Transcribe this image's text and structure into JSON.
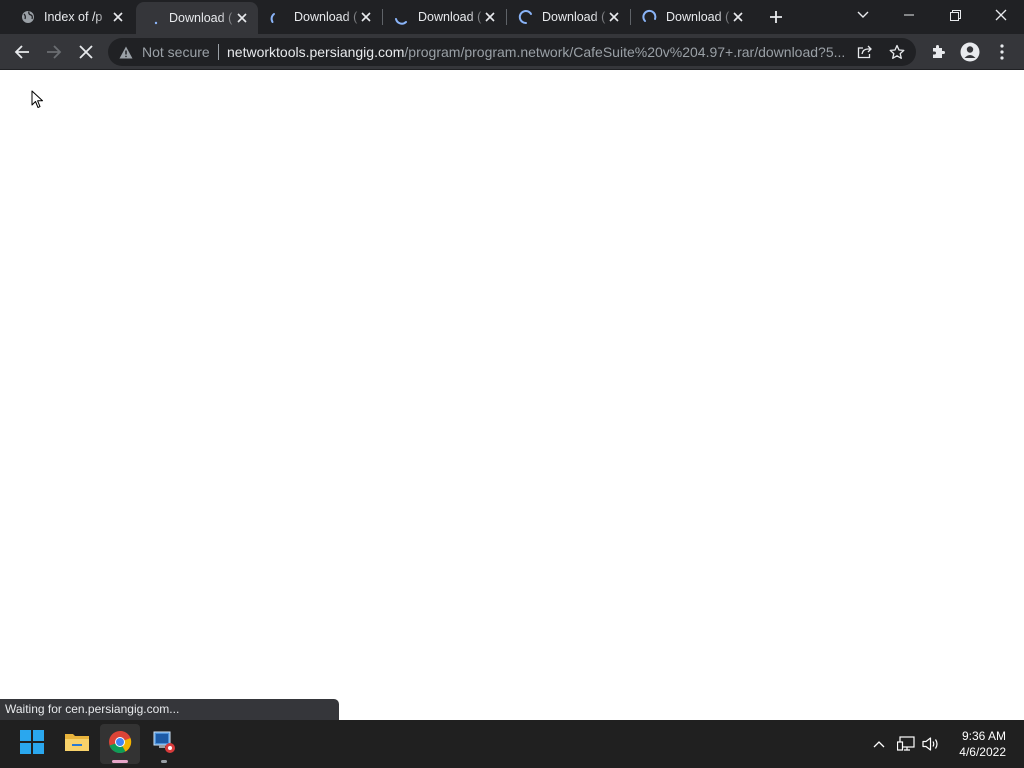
{
  "browser": {
    "tabs": [
      {
        "title": "Index of /p",
        "favicon": "globe-icon",
        "state": "loaded"
      },
      {
        "title": "Download (",
        "favicon": "loading-spinner-icon",
        "state": "active-loading"
      },
      {
        "title": "Download (",
        "favicon": "loading-spinner-icon",
        "state": "loading"
      },
      {
        "title": "Download (",
        "favicon": "loading-spinner-icon",
        "state": "loading"
      },
      {
        "title": "Download (",
        "favicon": "loading-spinner-icon",
        "state": "loading"
      },
      {
        "title": "Download (",
        "favicon": "loading-spinner-icon",
        "state": "loading"
      }
    ],
    "address_bar": {
      "security_label": "Not secure",
      "host": "networktools.persiangig.com",
      "path": "/program/program.network/CafeSuite%20v%204.97+.rar/download?5..."
    },
    "status_text": "Waiting for cen.persiangig.com...",
    "colors": {
      "tabstrip_bg": "#202124",
      "active_tab_bg": "#35363a",
      "spinner": "#8ab4f8",
      "text_primary": "#e8eaed",
      "text_secondary": "#9aa0a6"
    }
  },
  "taskbar": {
    "apps": [
      "start-icon",
      "file-explorer-icon",
      "chrome-icon",
      "remote-app-icon"
    ],
    "clock": {
      "time": "9:36 AM",
      "date": "4/6/2022"
    }
  }
}
